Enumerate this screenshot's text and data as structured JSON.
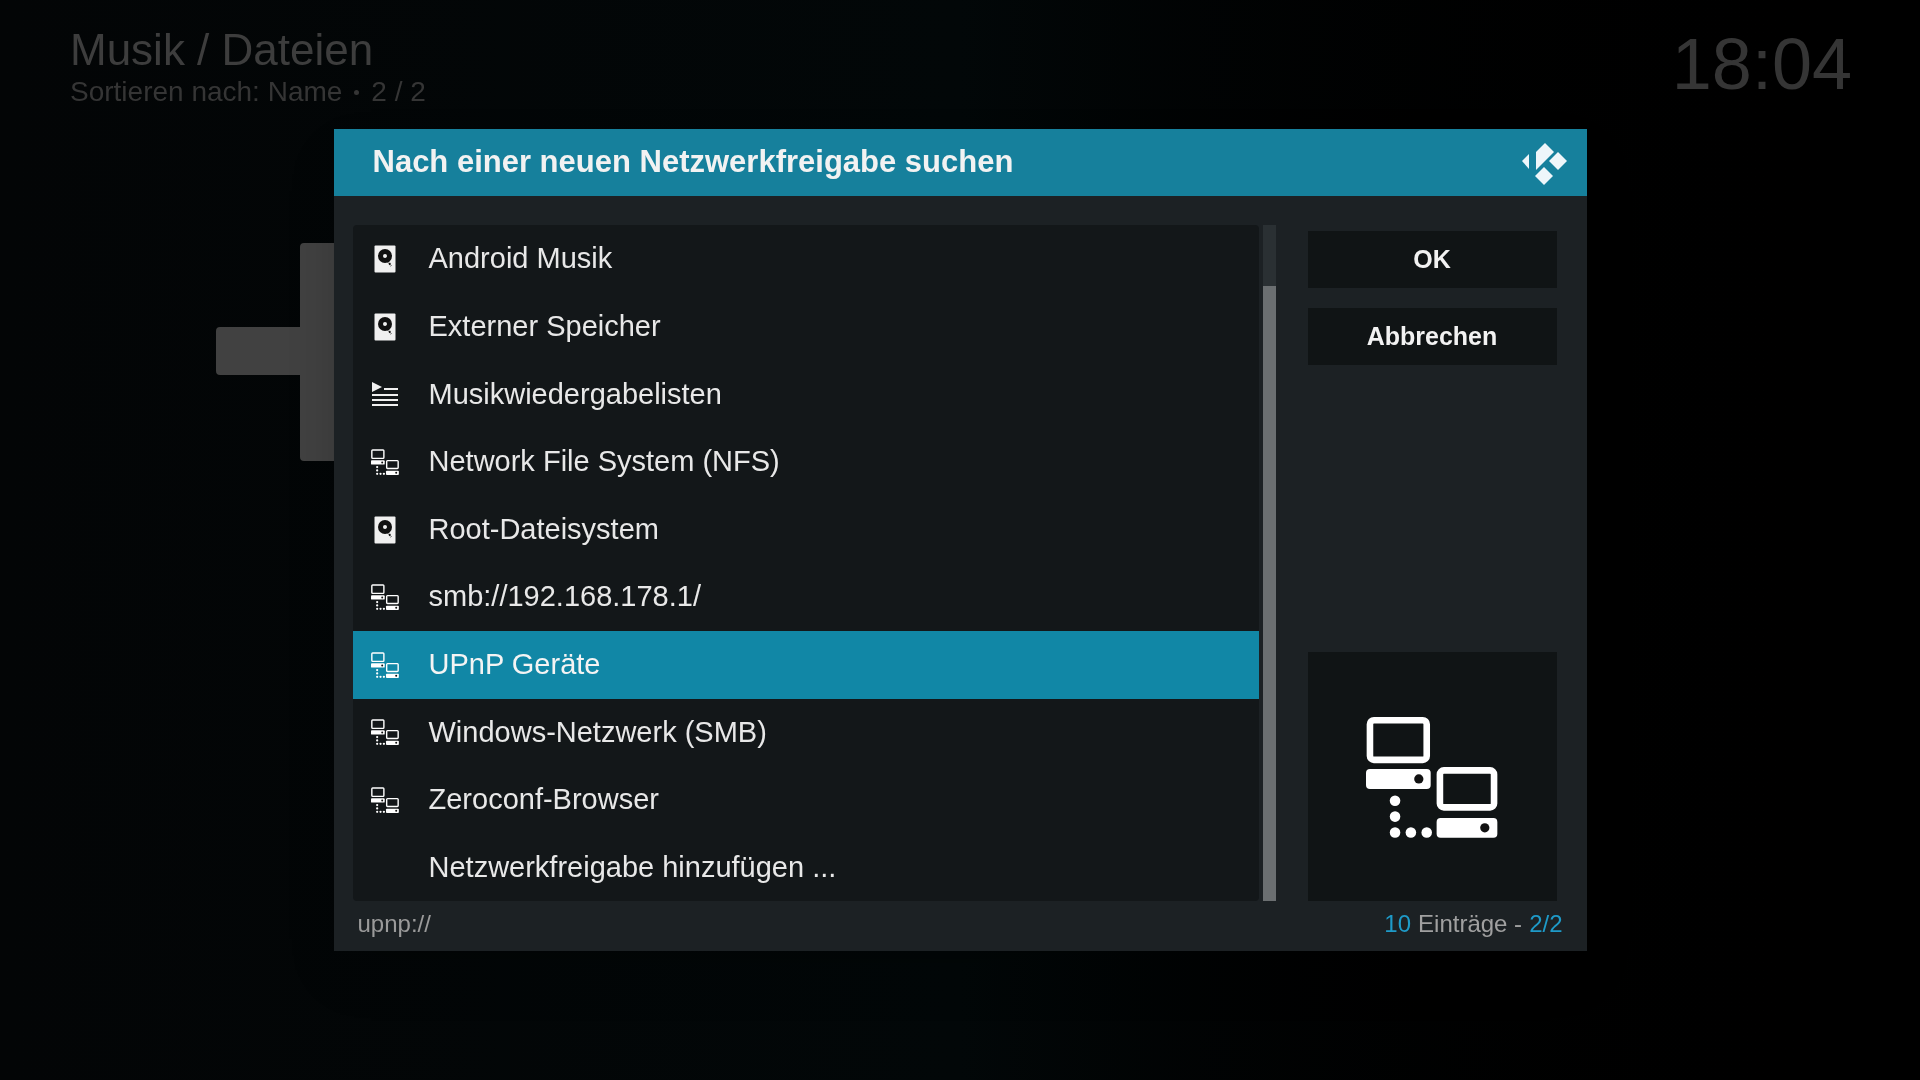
{
  "background": {
    "title": "Musik / Dateien",
    "subtitle": "Sortieren nach: Name",
    "subtitle_page": "2 / 2",
    "clock": "18:04"
  },
  "dialog": {
    "title": "Nach einer neuen Netzwerkfreigabe suchen",
    "items": [
      {
        "label": "Android Musik",
        "kind": "disk",
        "selected": false
      },
      {
        "label": "Externer Speicher",
        "kind": "disk",
        "selected": false
      },
      {
        "label": "Musikwiedergabelisten",
        "kind": "playlist",
        "selected": false
      },
      {
        "label": "Network File System (NFS)",
        "kind": "network",
        "selected": false
      },
      {
        "label": "Root-Dateisystem",
        "kind": "disk",
        "selected": false
      },
      {
        "label": "smb://192.168.178.1/",
        "kind": "network",
        "selected": false
      },
      {
        "label": "UPnP Geräte",
        "kind": "network",
        "selected": true
      },
      {
        "label": "Windows-Netzwerk (SMB)",
        "kind": "network",
        "selected": false
      },
      {
        "label": "Zeroconf-Browser",
        "kind": "network",
        "selected": false
      },
      {
        "label": "Netzwerkfreigabe hinzufügen ...",
        "kind": "plain",
        "selected": false
      }
    ],
    "buttons": [
      "OK",
      "Abbrechen"
    ],
    "path": "upnp://",
    "count": "10",
    "count_label": "Einträge -",
    "page": "2/2"
  }
}
